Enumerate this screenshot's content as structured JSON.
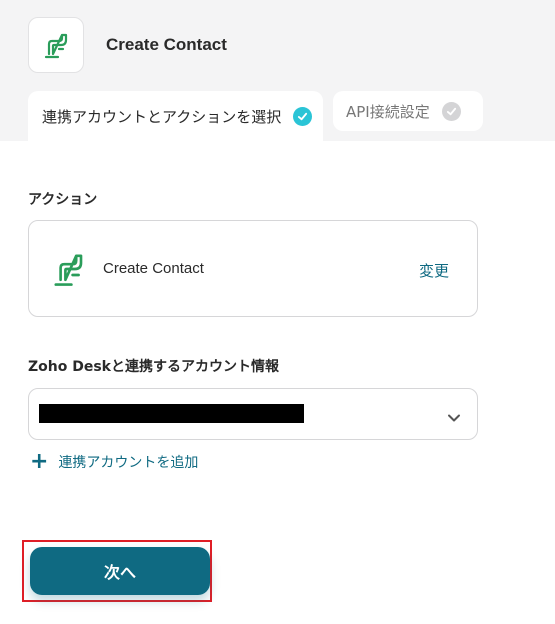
{
  "header": {
    "title": "Create Contact",
    "app_icon": "zoho-desk-icon",
    "brand_color": "#2a9d5a"
  },
  "tabs": [
    {
      "label": "連携アカウントとアクションを選択",
      "status": "complete"
    },
    {
      "label": "API接続設定",
      "status": "incomplete"
    }
  ],
  "action_section": {
    "label": "アクション",
    "action_name": "Create Contact",
    "change_label": "変更"
  },
  "account_section": {
    "label": "Zoho Deskと連携するアカウント情報",
    "add_account_label": "連携アカウントを追加"
  },
  "footer": {
    "next_label": "次へ",
    "accent": "#0f6a82"
  }
}
